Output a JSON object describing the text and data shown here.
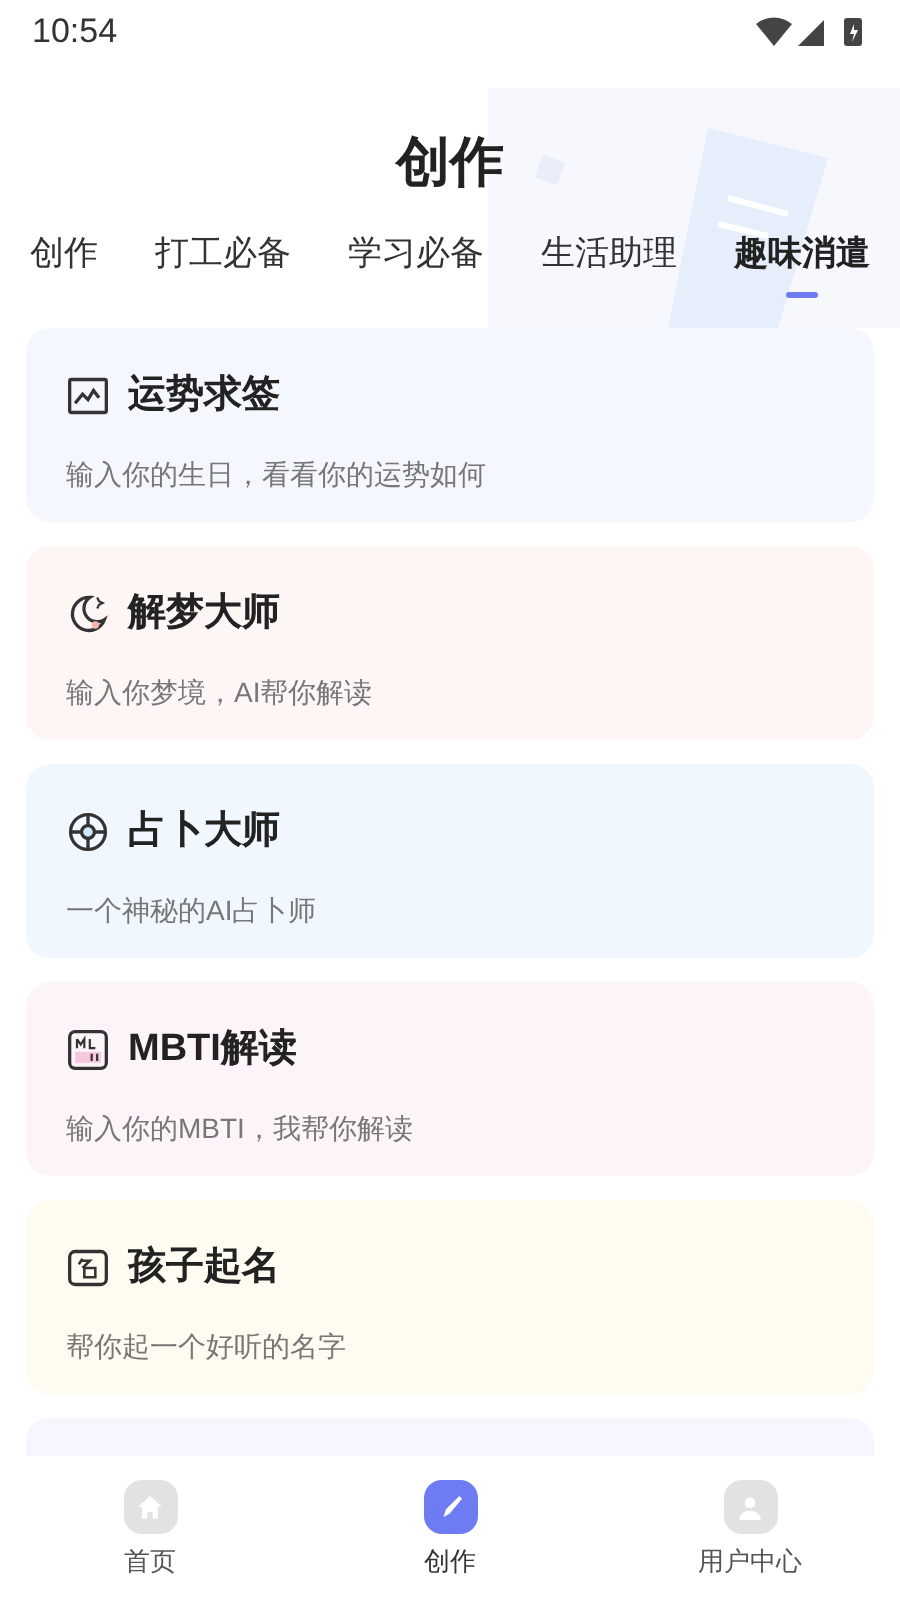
{
  "status_bar": {
    "time": "10:54"
  },
  "header": {
    "title": "创作"
  },
  "tabs": [
    {
      "label": "创作",
      "selected": false
    },
    {
      "label": "打工必备",
      "selected": false
    },
    {
      "label": "学习必备",
      "selected": false
    },
    {
      "label": "生活助理",
      "selected": false
    },
    {
      "label": "趣味消遣",
      "selected": true
    }
  ],
  "cards": [
    {
      "kind": "chart",
      "title": "运势求签",
      "subtitle": "输入你的生日，看看你的运势如何",
      "color": "#f5f7fe"
    },
    {
      "kind": "moon",
      "title": "解梦大师",
      "subtitle": "输入你梦境，AI帮你解读",
      "color": "#fef6f4"
    },
    {
      "kind": "ball",
      "title": "占卜大师",
      "subtitle": "一个神秘的AI占卜师",
      "color": "#f1f7fe"
    },
    {
      "kind": "mbti",
      "title": "MBTI解读",
      "subtitle": "输入你的MBTI，我帮你解读",
      "color": "#fdf4fa"
    },
    {
      "kind": "name",
      "title": "孩子起名",
      "subtitle": "帮你起一个好听的名字",
      "color": "#fefbf0"
    }
  ],
  "bottom_nav": [
    {
      "kind": "home",
      "label": "首页",
      "selected": false
    },
    {
      "kind": "create",
      "label": "创作",
      "selected": true
    },
    {
      "kind": "user",
      "label": "用户中心",
      "selected": false
    }
  ]
}
